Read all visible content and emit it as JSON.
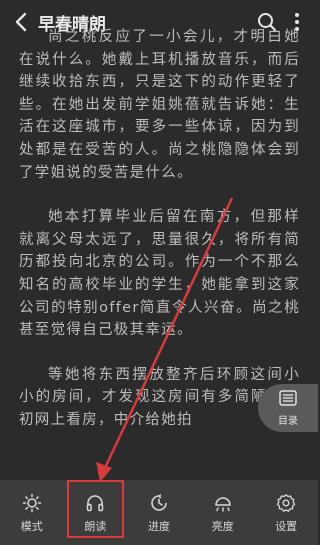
{
  "header": {
    "title": "早春晴朗"
  },
  "content": {
    "paragraphs": [
      "尚之桃反应了一小会儿，才明白她在说什么。她戴上耳机播放音乐，而后继续收拾东西，只是这下的动作更轻了些。在她出发前学姐姚蓓就告诉她：生活在这座城市，要多一些体谅，因为到处都是在受苦的人。尚之桃隐隐体会到了学姐说的受苦是什么。",
      "她本打算毕业后留在南方，但那样就离父母太远了，思量很久，将所有简历都投向北京的公司。作为一个不那么知名的高校毕业的学生，她能拿到这家公司的特别offer简直令人兴奋。尚之桃甚至觉得自己极其幸运。",
      "等她将东西摆放整齐后环顾这间小小的房间，才发现这房间有多简陋。当初网上看房，中介给她拍"
    ]
  },
  "toc": {
    "label": "目录"
  },
  "bottom_tabs": [
    {
      "label": "模式",
      "icon": "sun-mode-icon"
    },
    {
      "label": "朗读",
      "icon": "headphones-icon"
    },
    {
      "label": "进度",
      "icon": "progress-clock-icon"
    },
    {
      "label": "亮度",
      "icon": "brightness-icon"
    },
    {
      "label": "设置",
      "icon": "gear-icon"
    }
  ],
  "colors": {
    "background": "#2b2b2b",
    "bottom_bar": "#3c3c3c",
    "annotation": "#d93a3a"
  }
}
